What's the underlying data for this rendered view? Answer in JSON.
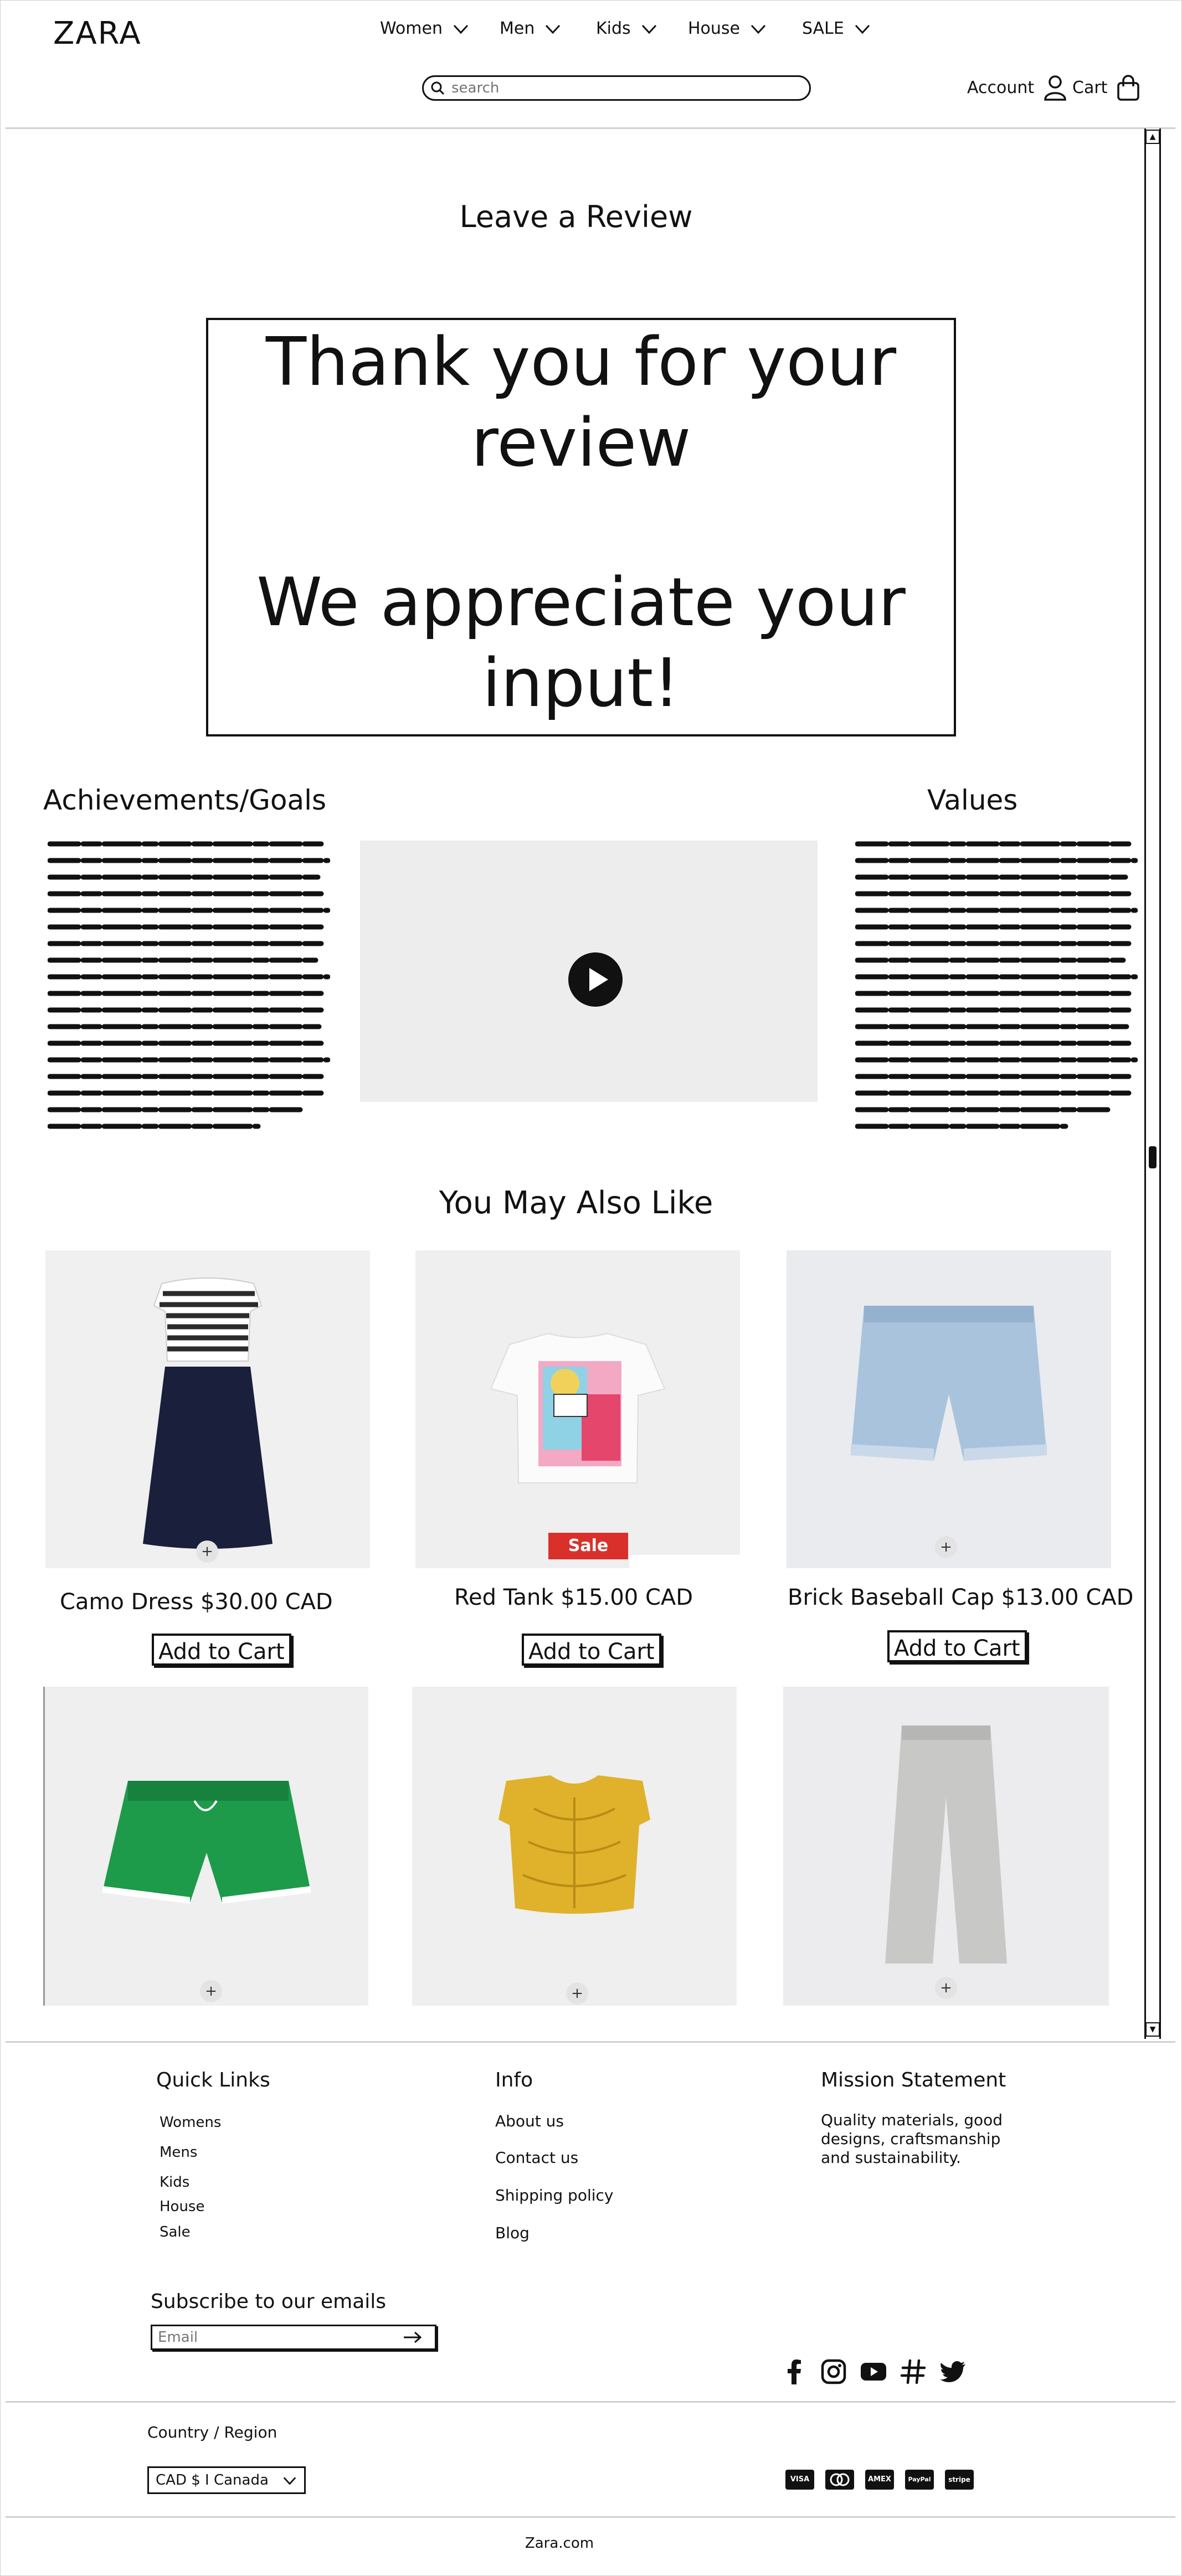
{
  "header": {
    "logo": "ZARA",
    "nav": [
      "Women",
      "Men",
      "Kids",
      "House",
      "SALE"
    ],
    "search_placeholder": "search",
    "account_label": "Account",
    "cart_label": "Cart"
  },
  "review": {
    "title": "Leave a Review",
    "thanks_line1": "Thank you for your",
    "thanks_line2": "review",
    "appreciate_line1": "We appreciate your",
    "appreciate_line2": "input!"
  },
  "about": {
    "achievements_title": "Achievements/Goals",
    "values_title": "Values"
  },
  "recommendations": {
    "title": "You May Also Like",
    "sale_badge": "Sale",
    "add_to_cart": "Add to Cart",
    "products": [
      {
        "name": "Camo Dress $30.00 CAD"
      },
      {
        "name": "Red Tank $15.00 CAD"
      },
      {
        "name": "Brick Baseball Cap $13.00 CAD"
      }
    ]
  },
  "footer": {
    "quick_links_title": "Quick Links",
    "quick_links": [
      "Womens",
      "Mens",
      "Kids",
      "House",
      "Sale"
    ],
    "info_title": "Info",
    "info_links": [
      "About us",
      "Contact us",
      "Shipping policy",
      "Blog"
    ],
    "mission_title": "Mission Statement",
    "mission_text": "Quality materials, good designs, craftsmanship and sustainability.",
    "subscribe_title": "Subscribe to our emails",
    "email_placeholder": "Email",
    "social_icons": [
      "facebook-icon",
      "instagram-icon",
      "youtube-icon",
      "hashtag-icon",
      "twitter-icon"
    ],
    "country_label": "Country / Region",
    "region_value": "CAD $ I Canada",
    "payment_methods": [
      "VISA",
      "MC",
      "AMEX",
      "PayPal",
      "stripe"
    ],
    "copyright": "Zara.com"
  }
}
